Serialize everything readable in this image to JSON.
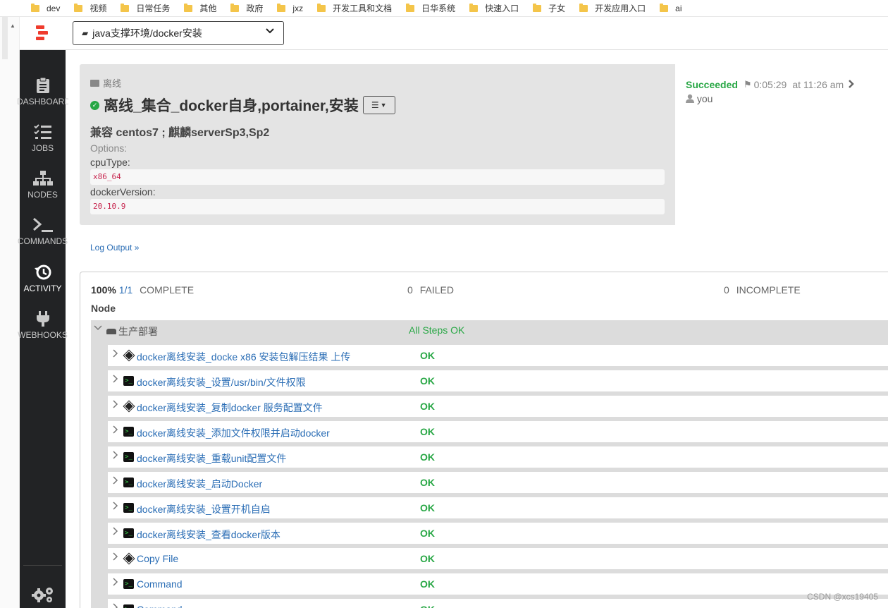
{
  "bookmarks": [
    "dev",
    "视频",
    "日常任务",
    "其他",
    "政府",
    "jxz",
    "开发工具和文档",
    "日华系统",
    "快速入口",
    "子女",
    "开发应用入口",
    "ai"
  ],
  "header": {
    "project": "java支撑环境/docker安装"
  },
  "sidebar": {
    "items": [
      {
        "label": "DASHBOARD",
        "icon": "clipboard-icon"
      },
      {
        "label": "JOBS",
        "icon": "list-check-icon"
      },
      {
        "label": "NODES",
        "icon": "sitemap-icon"
      },
      {
        "label": "COMMANDS",
        "icon": "terminal-icon"
      },
      {
        "label": "ACTIVITY",
        "icon": "history-icon"
      },
      {
        "label": "WEBHOOKS",
        "icon": "plug-icon"
      }
    ],
    "settings_icon": "gear-icon"
  },
  "job": {
    "group": "离线",
    "title": "离线_集合_docker自身,portainer,安装",
    "description": "兼容 centos7 ; 麒麟serverSp3,Sp2",
    "options_label": "Options:",
    "options": [
      {
        "name": "cpuType:",
        "value": "x86_64"
      },
      {
        "name": "dockerVersion:",
        "value": "20.10.9"
      }
    ]
  },
  "execution": {
    "status": "Succeeded",
    "duration": "0:05:29",
    "time": "at 11:26 am",
    "user": "you"
  },
  "log_output_link": "Log Output »",
  "summary_stats": {
    "percent": "100%",
    "fraction": "1/1",
    "complete_label": "COMPLETE",
    "failed_count": "0",
    "failed_label": "FAILED",
    "incomplete_count": "0",
    "incomplete_label": "INCOMPLETE"
  },
  "node_header": "Node",
  "node": {
    "name": "生产部署",
    "status": "All Steps OK"
  },
  "steps": [
    {
      "name": "docker离线安装_docke x86 安装包解压结果 上传",
      "type": "diamond",
      "status": "OK"
    },
    {
      "name": "docker离线安装_设置/usr/bin/文件权限",
      "type": "terminal",
      "status": "OK"
    },
    {
      "name": "docker离线安装_复制docker 服务配置文件",
      "type": "diamond",
      "status": "OK"
    },
    {
      "name": "docker离线安装_添加文件权限并启动docker",
      "type": "terminal",
      "status": "OK"
    },
    {
      "name": "docker离线安装_重载unit配置文件",
      "type": "terminal",
      "status": "OK"
    },
    {
      "name": "docker离线安装_启动Docker",
      "type": "terminal",
      "status": "OK"
    },
    {
      "name": "docker离线安装_设置开机自启",
      "type": "terminal",
      "status": "OK"
    },
    {
      "name": "docker离线安装_查看docker版本",
      "type": "terminal",
      "status": "OK"
    },
    {
      "name": "Copy File",
      "type": "diamond",
      "status": "OK"
    },
    {
      "name": "Command",
      "type": "terminal",
      "status": "OK"
    },
    {
      "name": "Command",
      "type": "terminal",
      "status": "OK"
    }
  ],
  "watermark": "CSDN @xcs19405",
  "colors": {
    "success": "#28a745",
    "link": "#2a6db5",
    "sidebar": "#222325",
    "brand": "#ef3b2d"
  }
}
